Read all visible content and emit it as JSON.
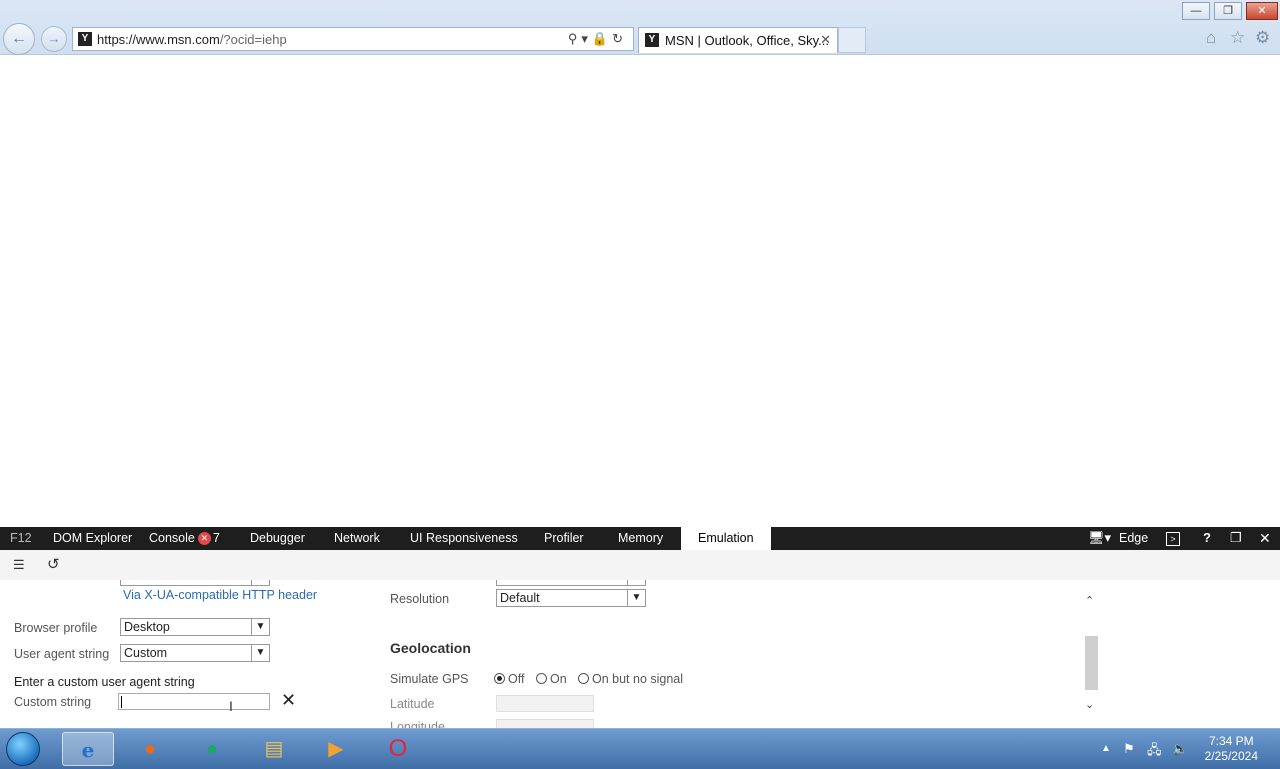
{
  "browser": {
    "url_main": "https://www.msn.com",
    "url_rest": "/?ocid=iehp",
    "tab_title": "MSN | Outlook, Office, Sky...",
    "tab_close": "✕",
    "window_controls": {
      "minimize": "—",
      "restore": "❐",
      "close": "✕"
    }
  },
  "devtools": {
    "tabs": [
      {
        "label": "F12"
      },
      {
        "label": "DOM Explorer"
      },
      {
        "label": "Console"
      },
      {
        "label": "Debugger"
      },
      {
        "label": "Network"
      },
      {
        "label": "UI Responsiveness"
      },
      {
        "label": "Profiler"
      },
      {
        "label": "Memory"
      },
      {
        "label": "Emulation"
      }
    ],
    "console_error_count": "7",
    "document_mode_value": "Edge"
  },
  "emulation": {
    "xua_link": "Via X-UA-compatible HTTP header",
    "browser_profile_label": "Browser profile",
    "browser_profile_value": "Desktop",
    "user_agent_label": "User agent string",
    "user_agent_value": "Custom",
    "custom_ua_heading": "Enter a custom user agent string",
    "custom_string_label": "Custom string",
    "custom_string_value": "",
    "clear_button": "✕",
    "resolution_label": "Resolution",
    "resolution_value": "Default",
    "geolocation_heading": "Geolocation",
    "simulate_gps_label": "Simulate GPS",
    "gps_options": [
      "Off",
      "On",
      "On but no signal"
    ],
    "gps_selected": "Off",
    "latitude_label": "Latitude",
    "longitude_label": "Longitude"
  },
  "taskbar": {
    "time": "7:34 PM",
    "date": "2/25/2024"
  }
}
